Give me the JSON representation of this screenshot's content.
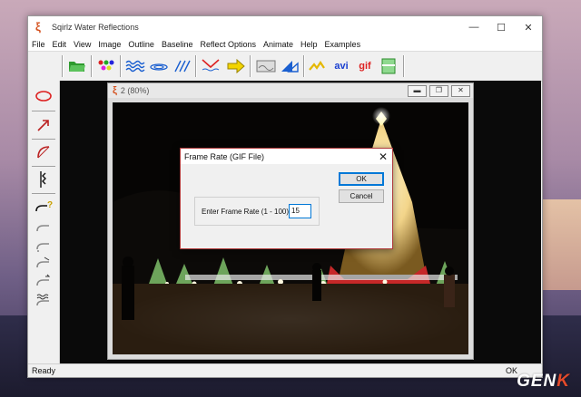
{
  "window": {
    "title": "Sqirlz Water Reflections",
    "minimize": "—",
    "maximize": "☐",
    "close": "✕"
  },
  "menu": [
    "File",
    "Edit",
    "View",
    "Image",
    "Outline",
    "Baseline",
    "Reflect Options",
    "Animate",
    "Help",
    "Examples"
  ],
  "toolbar": {
    "avi_label": "avi",
    "gif_label": "gif"
  },
  "child_window": {
    "title": "2  (80%)"
  },
  "dialog": {
    "title": "Frame Rate (GIF File)",
    "close": "✕",
    "field_label": "Enter Frame Rate (1 - 100)",
    "field_value": "15",
    "ok_label": "OK",
    "cancel_label": "Cancel"
  },
  "status": {
    "left": "Ready",
    "right": "OK"
  },
  "watermark": {
    "prefix": "GEN",
    "suffix": "K"
  }
}
